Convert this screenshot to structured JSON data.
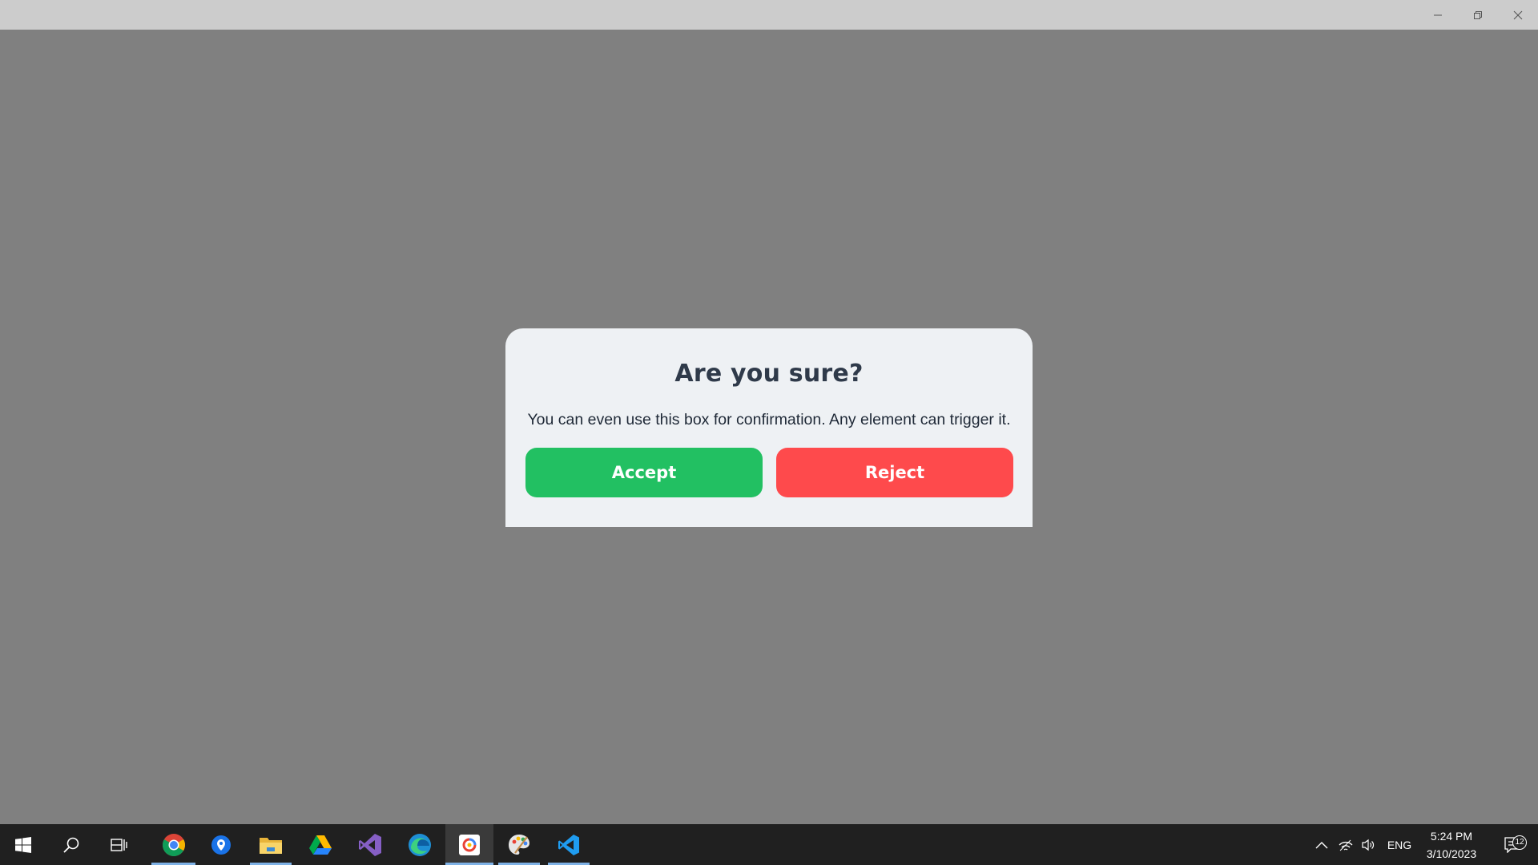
{
  "dialog": {
    "title": "Are you sure?",
    "message": "You can even use this box for confirmation. Any element can trigger it.",
    "accept_label": "Accept",
    "reject_label": "Reject"
  },
  "colors": {
    "overlay": "#808080",
    "dialog_bg": "#eef1f4",
    "accept": "#22c062",
    "reject": "#fe4a4c",
    "title_text": "#2f3a4a",
    "taskbar": "#202020",
    "titlebar": "#cccccc"
  },
  "window_controls": [
    "minimize-icon",
    "restore-icon",
    "close-icon"
  ],
  "taskbar": {
    "apps": [
      {
        "name": "start-icon"
      },
      {
        "name": "search-icon"
      },
      {
        "name": "task-view-icon"
      },
      {
        "name": "chrome-icon",
        "running": true
      },
      {
        "name": "maps-pin-icon"
      },
      {
        "name": "file-explorer-icon",
        "running": true
      },
      {
        "name": "google-drive-icon"
      },
      {
        "name": "visual-studio-icon"
      },
      {
        "name": "edge-icon"
      },
      {
        "name": "app-icon",
        "active": true
      },
      {
        "name": "paint-palette-icon",
        "running": true
      },
      {
        "name": "vscode-icon",
        "running": true
      }
    ],
    "tray": {
      "language": "ENG",
      "time": "5:24 PM",
      "date": "3/10/2023",
      "notifications": "12"
    }
  }
}
